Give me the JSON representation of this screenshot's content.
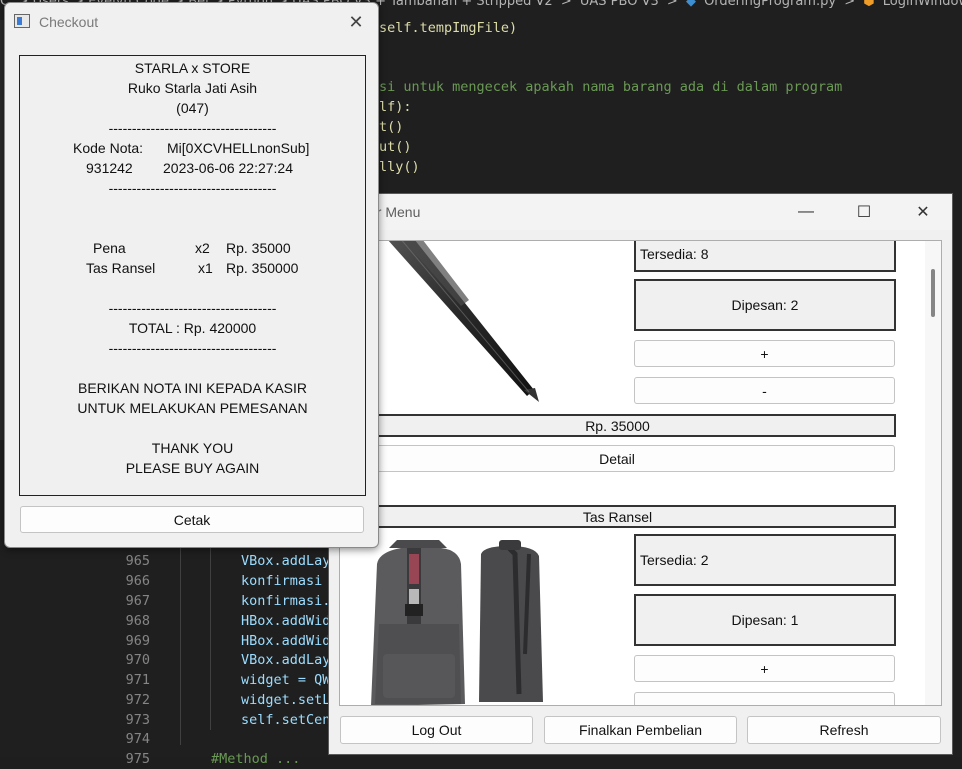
{
  "editor": {
    "breadcrumb": [
      "C: > Users > Evelyn Code > Bel > Python > UAS PBO V3 + Tambahan + Stripped V2",
      ">",
      "UAS PBO V3",
      ">",
      "OrderingProgram.py",
      ">",
      "LoginWindow"
    ],
    "code_top": [
      {
        "text": "self.tempImgFile)"
      },
      {
        "text": "si untuk mengecek apakah nama barang ada di dalam program"
      },
      {
        "text": "lf):"
      },
      {
        "text": "t()"
      },
      {
        "text": "ut()"
      },
      {
        "text": "lly()"
      }
    ],
    "line_numbers": [
      "965",
      "966",
      "967",
      "968",
      "969",
      "970",
      "971",
      "972",
      "973",
      "974",
      "975"
    ],
    "code_bottom": [
      "VBox.addLay",
      "konfirmasi",
      "konfirmasi.",
      "HBox.addWid",
      "HBox.addWid",
      "VBox.addLay",
      "widget = QW",
      "widget.setL",
      "self.setCen",
      "",
      "#Method ..."
    ],
    "colors": {
      "bg": "#1f1f1f",
      "comment": "#6a9955",
      "func": "#dcdcaa",
      "var": "#9cdcfe"
    }
  },
  "order_window": {
    "title": "er Menu",
    "controls": {
      "minimize": "—",
      "maximize": "☐",
      "close": "✕"
    },
    "items": [
      {
        "name": "Pena",
        "stock_label": "Tersedia: 8",
        "ordered_label": "Dipesan: 2",
        "plus_label": "+",
        "minus_label": "-",
        "price_label": "Rp. 35000",
        "detail_label": "Detail",
        "image": "pen-image"
      },
      {
        "name": "Tas Ransel",
        "stock_label": "Tersedia: 2",
        "ordered_label": "Dipesan: 1",
        "plus_label": "+",
        "image": "backpack-image"
      }
    ],
    "buttons": {
      "logout": "Log Out",
      "finalize": "Finalkan Pembelian",
      "refresh": "Refresh"
    }
  },
  "checkout_window": {
    "title": "Checkout",
    "close": "✕",
    "receipt": {
      "store_name": "STARLA x STORE",
      "address": "Ruko Starla Jati Asih",
      "branch": "(047)",
      "separator": "------------------------------------",
      "kode_label": "Kode Nota:",
      "kode_value": "Mi[0XCVHELLnonSub]",
      "number": "931242",
      "datetime": "2023-06-06 22:27:24",
      "lines": [
        {
          "name": "Pena",
          "qty": "x2",
          "price": "Rp. 35000"
        },
        {
          "name": "Tas Ransel",
          "qty": "x1",
          "price": "Rp. 350000"
        }
      ],
      "total": "TOTAL : Rp. 420000",
      "msg1": "BERIKAN NOTA INI KEPADA KASIR",
      "msg2": "UNTUK MELAKUKAN PEMESANAN",
      "thanks1": "THANK YOU",
      "thanks2": "PLEASE BUY AGAIN"
    },
    "print_button": "Cetak"
  }
}
